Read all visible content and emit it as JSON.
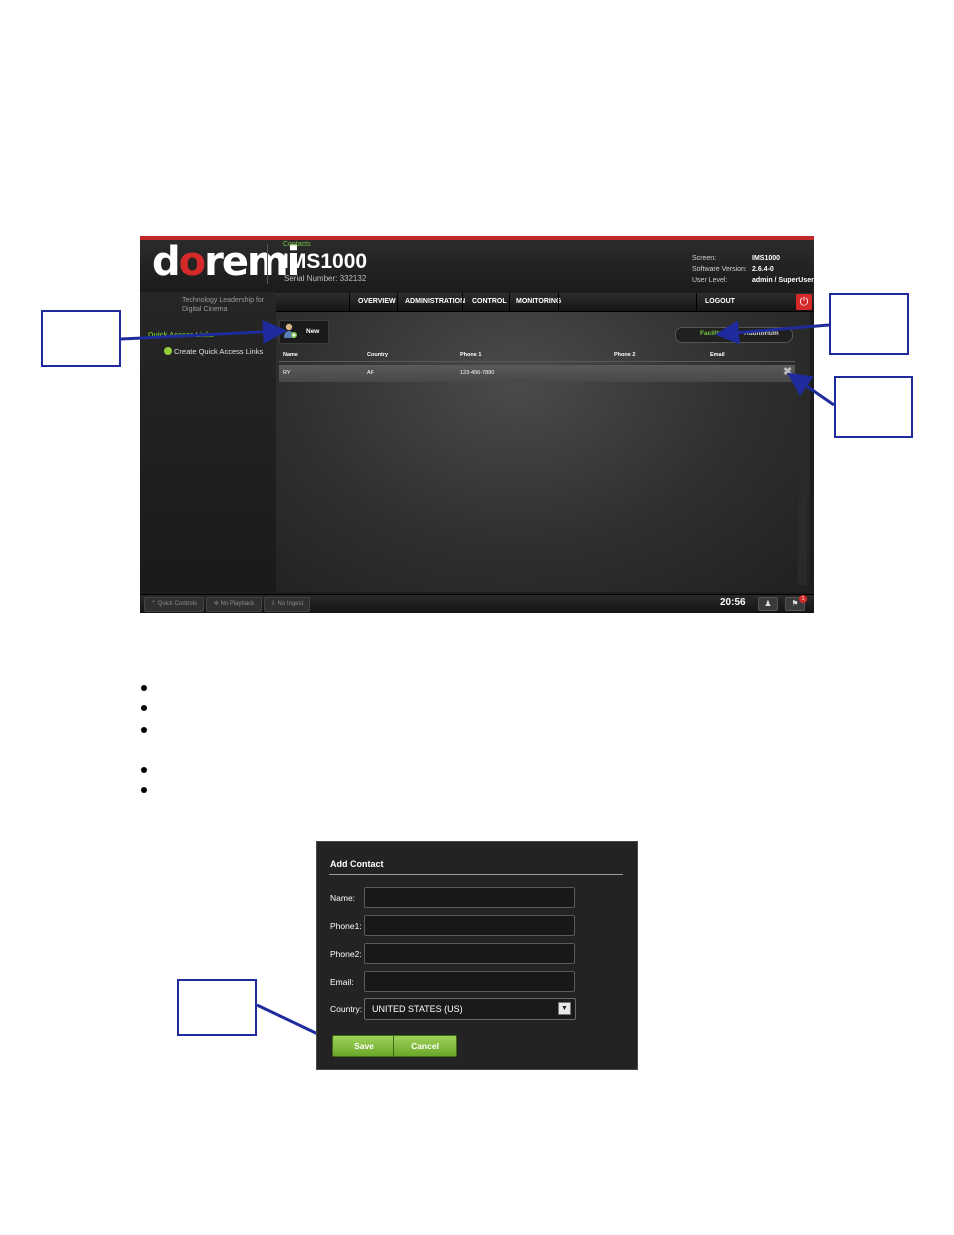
{
  "app": {
    "logo": "doremi",
    "product": "IMS1000",
    "serial": "Serial Number: 332132",
    "info": [
      {
        "label": "Screen:",
        "value": "IMS1000"
      },
      {
        "label": "Software Version:",
        "value": "2.6.4-0"
      },
      {
        "label": "User Level:",
        "value": "admin / SuperUser"
      }
    ],
    "tagline": "Technology Leadership for Digital Cinema",
    "quick_access_title": "Quick Access Links",
    "quick_access_link": "Create Quick Access Links",
    "nav": {
      "contacts": "Contacts",
      "overview": "OVERVIEW",
      "administration": "ADMINISTRATION",
      "control": "CONTROL",
      "monitoring": "MONITORING",
      "logout": "LOGOUT"
    },
    "new_button": "New",
    "tabs": {
      "facility": "Facility",
      "auditorium": "Auditorium"
    },
    "table": {
      "columns": [
        "Name",
        "Country",
        "Phone 1",
        "Phone 2",
        "Email"
      ],
      "rows": [
        {
          "name": "RY",
          "country": "AF",
          "phone1": "123-456-7890",
          "phone2": "",
          "email": ""
        }
      ]
    },
    "status": {
      "quick_controls": "Quick Controls",
      "playback": "No Playback",
      "ingest": "No Ingest",
      "time": "20:56",
      "notification_count": "1"
    },
    "accent_color": "#7ac943",
    "brand_red": "#d42a2a"
  },
  "dialog": {
    "title": "Add Contact",
    "labels": {
      "name": "Name:",
      "phone1": "Phone1:",
      "phone2": "Phone2:",
      "email": "Email:",
      "country": "Country:"
    },
    "values": {
      "name": "",
      "phone1": "",
      "phone2": "",
      "email": ""
    },
    "country_selected": "UNITED STATES (US)",
    "save": "Save",
    "cancel": "Cancel"
  }
}
